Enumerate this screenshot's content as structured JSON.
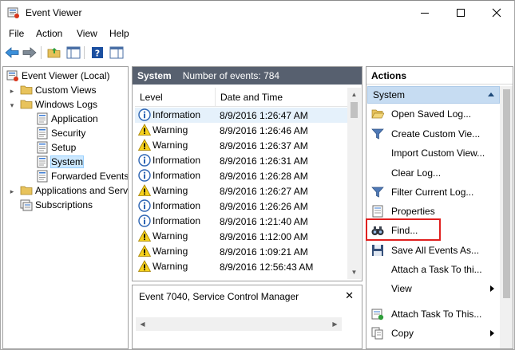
{
  "window": {
    "title": "Event Viewer"
  },
  "menu": {
    "items": [
      "File",
      "Action",
      "View",
      "Help"
    ]
  },
  "tree": {
    "items": [
      {
        "label": "Event Viewer (Local)",
        "icon": "event-viewer-icon"
      },
      {
        "label": "Custom Views",
        "icon": "folder-icon"
      },
      {
        "label": "Windows Logs",
        "icon": "folder-icon"
      },
      {
        "label": "Application",
        "icon": "log-icon"
      },
      {
        "label": "Security",
        "icon": "log-icon"
      },
      {
        "label": "Setup",
        "icon": "log-icon"
      },
      {
        "label": "System",
        "icon": "log-icon"
      },
      {
        "label": "Forwarded Events",
        "icon": "log-icon"
      },
      {
        "label": "Applications and Services Logs",
        "icon": "folder-icon"
      },
      {
        "label": "Subscriptions",
        "icon": "subscriptions-icon"
      }
    ]
  },
  "center": {
    "title": "System",
    "count_text": "Number of events: 784",
    "columns": [
      "Level",
      "Date and Time"
    ],
    "rows": [
      {
        "level": "Information",
        "datetime": "8/9/2016 1:26:47 AM"
      },
      {
        "level": "Warning",
        "datetime": "8/9/2016 1:26:46 AM"
      },
      {
        "level": "Warning",
        "datetime": "8/9/2016 1:26:37 AM"
      },
      {
        "level": "Information",
        "datetime": "8/9/2016 1:26:31 AM"
      },
      {
        "level": "Information",
        "datetime": "8/9/2016 1:26:28 AM"
      },
      {
        "level": "Warning",
        "datetime": "8/9/2016 1:26:27 AM"
      },
      {
        "level": "Information",
        "datetime": "8/9/2016 1:26:26 AM"
      },
      {
        "level": "Information",
        "datetime": "8/9/2016 1:21:40 AM"
      },
      {
        "level": "Warning",
        "datetime": "8/9/2016 1:12:00 AM"
      },
      {
        "level": "Warning",
        "datetime": "8/9/2016 1:09:21 AM"
      },
      {
        "level": "Warning",
        "datetime": "8/9/2016 12:56:43 AM"
      }
    ]
  },
  "detail": {
    "title": "Event 7040, Service Control Manager"
  },
  "actions": {
    "header": "Actions",
    "section": "System",
    "items": [
      {
        "label": "Open Saved Log...",
        "icon": "open-folder-icon"
      },
      {
        "label": "Create Custom Vie...",
        "icon": "filter-icon"
      },
      {
        "label": "Import Custom View...",
        "icon": ""
      },
      {
        "label": "Clear Log...",
        "icon": ""
      },
      {
        "label": "Filter Current Log...",
        "icon": "filter-icon"
      },
      {
        "label": "Properties",
        "icon": "properties-icon"
      },
      {
        "label": "Find...",
        "icon": "binoculars-icon"
      },
      {
        "label": "Save All Events As...",
        "icon": "save-icon"
      },
      {
        "label": "Attach a Task To thi...",
        "icon": ""
      },
      {
        "label": "View",
        "icon": ""
      },
      {
        "label": "Attach Task To This...",
        "icon": "attach-task-icon"
      },
      {
        "label": "Copy",
        "icon": "copy-icon"
      }
    ]
  }
}
